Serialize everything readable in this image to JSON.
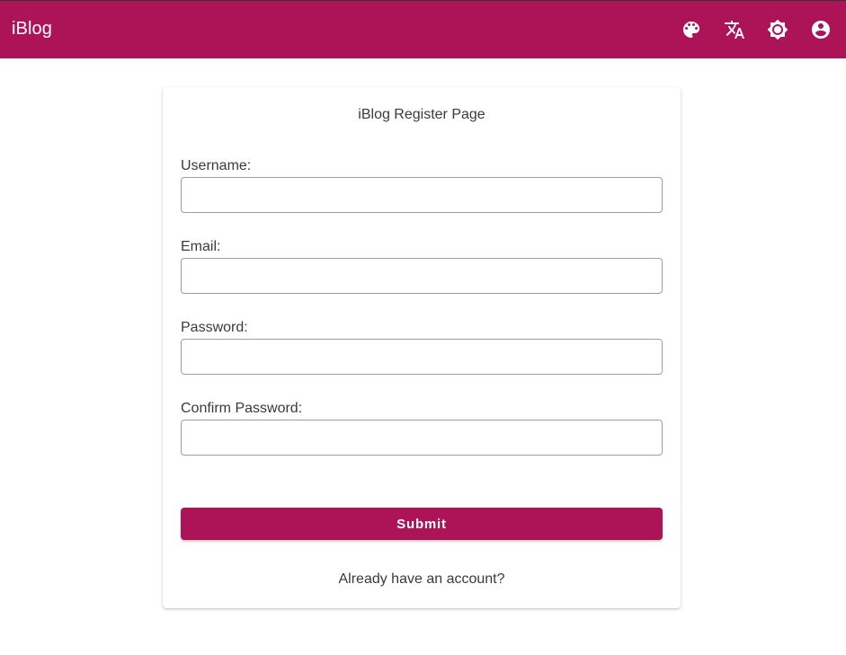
{
  "header": {
    "brand": "iBlog",
    "icons": [
      "palette-icon",
      "translate-icon",
      "brightness-icon",
      "account-icon"
    ],
    "background": "#ad1457"
  },
  "form": {
    "title": "iBlog Register Page",
    "fields": [
      {
        "label": "Username:",
        "value": "",
        "placeholder": ""
      },
      {
        "label": "Email:",
        "value": "",
        "placeholder": ""
      },
      {
        "label": "Password:",
        "value": "",
        "placeholder": ""
      },
      {
        "label": "Confirm Password:",
        "value": "",
        "placeholder": ""
      }
    ],
    "submit_label": "Submit",
    "login_link": "Already have an account?"
  },
  "colors": {
    "accent": "#ad1457",
    "text": "#3a3a3a",
    "border": "#9e9e9e"
  }
}
